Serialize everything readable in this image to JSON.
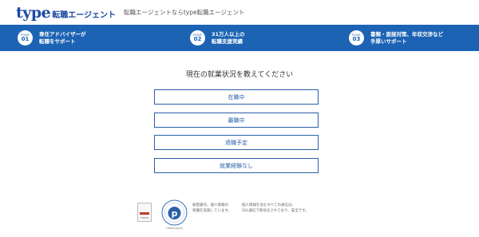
{
  "header": {
    "logo_type": "type",
    "logo_sub": "転職エージェント",
    "tagline": "転職エージェントならtype転職エージェント"
  },
  "points": [
    {
      "label": "POINT",
      "num": "01",
      "line1": "専任アドバイザーが",
      "line2": "転職をサポート"
    },
    {
      "label": "POINT",
      "num": "02",
      "line1": "31万人以上の",
      "line2": "転職支援実績"
    },
    {
      "label": "POINT",
      "num": "03",
      "line1": "書類・面接対策、年収交渉など",
      "line2": "手厚いサポート"
    }
  ],
  "question": "現在の就業状況を教えてください",
  "options": [
    "在職中",
    "離職中",
    "退職予定",
    "就業経験なし"
  ],
  "footer": {
    "seal_text": "TOKYO",
    "pmark_text": "プライバシー",
    "pmark_number": "10824076(04)",
    "note1_line1": "秘密厳守。個人情報の",
    "note1_line2": "保護を実施しています。",
    "note2_line1": "個人情報を含むすべての通信は、",
    "note2_line2": "SSL通信で暗号化されており、安全です。"
  },
  "colors": {
    "brand": "#1b4aa2",
    "banner": "#1c63b4",
    "option_border": "#2a5fa8"
  }
}
